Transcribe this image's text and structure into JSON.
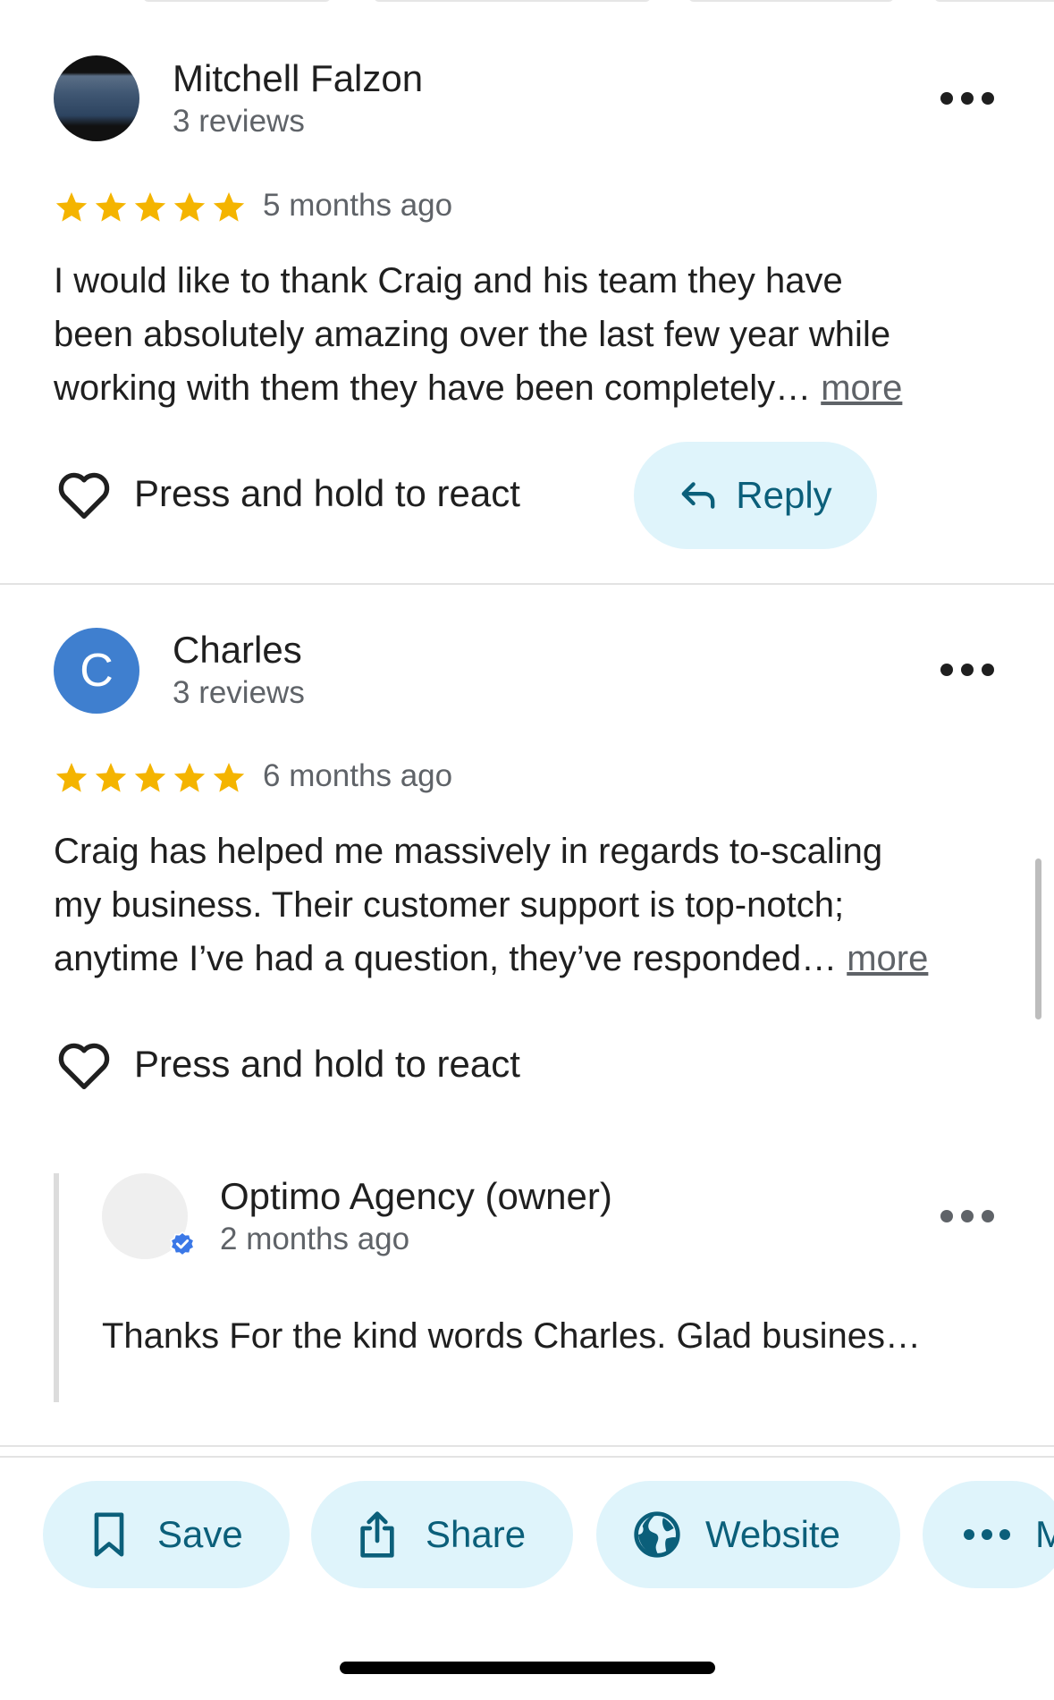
{
  "reviews": [
    {
      "name": "Mitchell Falzon",
      "review_count": "3 reviews",
      "rating": 5,
      "time": "5 months ago",
      "text_lines": [
        "I would like to thank Craig and his team they have",
        "been absolutely  amazing over the last few year while",
        "working with them they have been completely…"
      ],
      "more_label": "more",
      "react_label": "Press and hold to react",
      "reply_label": "Reply"
    },
    {
      "name": "Charles",
      "avatar_letter": "C",
      "review_count": "3 reviews",
      "rating": 5,
      "time": "6 months ago",
      "text_lines": [
        "Craig has helped me massively in regards to-scaling",
        "my business. Their customer support is top-notch;",
        "anytime I’ve had a question, they’ve responded…"
      ],
      "more_label": "more",
      "react_label": "Press and hold to react",
      "owner_response": {
        "name": "Optimo Agency (owner)",
        "time": "2 months ago",
        "text": "Thanks For the kind words Charles. Glad busines…"
      }
    }
  ],
  "action_bar": {
    "save": "Save",
    "share": "Share",
    "website": "Website",
    "more": "M"
  },
  "icons": {
    "star": "star-icon",
    "heart": "heart-outline-icon",
    "reply": "reply-arrow-icon",
    "more": "more-horizontal-icon",
    "save": "bookmark-icon",
    "share": "share-icon",
    "website": "globe-icon",
    "verified": "verified-badge-icon"
  },
  "colors": {
    "star": "#f4b400",
    "action_bg": "#dff4fb",
    "action_text": "#0b5f7a",
    "avatar_charles": "#3f7fcf",
    "verified": "#3b78e7"
  }
}
